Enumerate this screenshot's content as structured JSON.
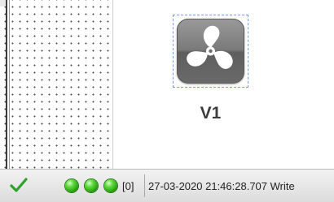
{
  "component": {
    "name": "V1",
    "icon": "fan-icon"
  },
  "statusbar": {
    "status_icon": "checkmark-icon",
    "leds": [
      "green",
      "green",
      "green"
    ],
    "counter": "[0]",
    "message": "27-03-2020 21:46:28.707 Write"
  },
  "colors": {
    "led_green": "#3cc21e",
    "tile_gray": "#7a7a7a",
    "check_green": "#2fa12a"
  }
}
